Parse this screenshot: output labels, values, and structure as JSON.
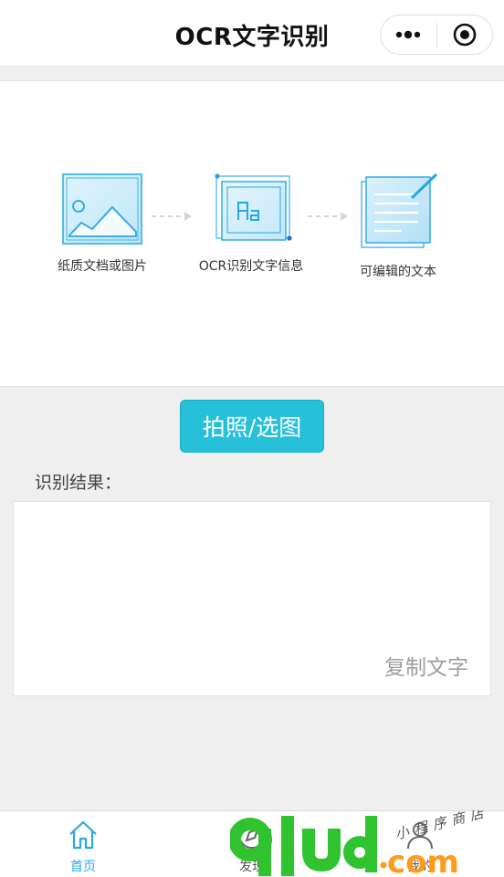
{
  "header": {
    "title": "OCR文字识别"
  },
  "illustration": {
    "steps": [
      {
        "label": "纸质文档或图片",
        "icon": "image-icon"
      },
      {
        "label": "OCR识别文字信息",
        "icon": "ocr-text-icon"
      },
      {
        "label": "可编辑的文本",
        "icon": "editable-document-icon"
      }
    ]
  },
  "main": {
    "action_button": "拍照/选图",
    "result_label": "识别结果：",
    "result_text": "",
    "copy_label": "复制文字"
  },
  "tabbar": {
    "items": [
      {
        "label": "首页",
        "icon": "home-icon",
        "active": true
      },
      {
        "label": "发现",
        "icon": "compass-icon",
        "active": false
      },
      {
        "label": "我的",
        "icon": "user-icon",
        "active": false
      }
    ]
  },
  "watermark": {
    "main": "9lud.com",
    "handwritten": "小程序商店"
  },
  "colors": {
    "accent": "#27c0d9",
    "tab_active": "#2aa8e6",
    "illustration_blue": "#27a6e8"
  }
}
